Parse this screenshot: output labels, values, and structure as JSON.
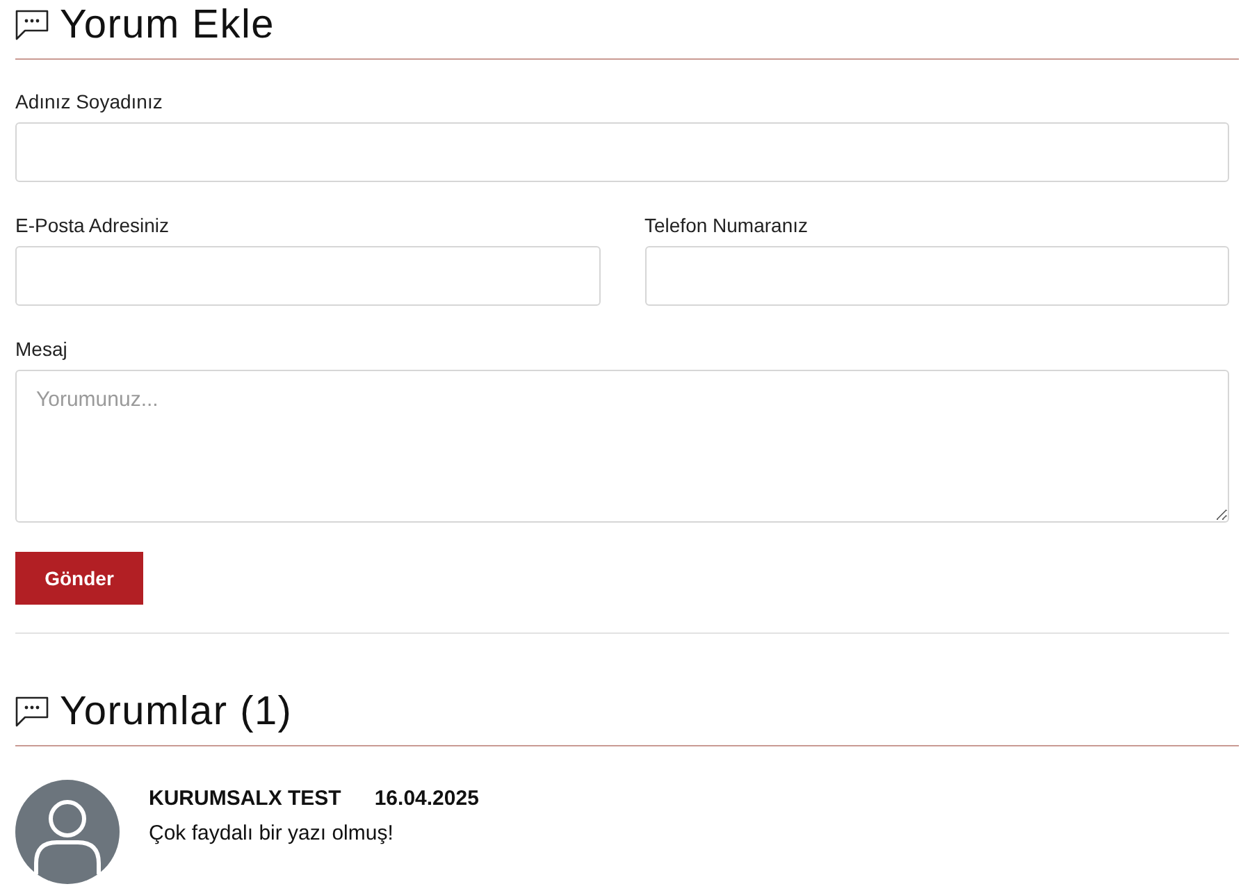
{
  "form_section": {
    "title": "Yorum Ekle"
  },
  "field_rows": [
    [
      {
        "label": "Adınız Soyadınız",
        "kind": "text"
      }
    ],
    [
      {
        "label": "E-Posta Adresiniz",
        "kind": "text"
      },
      {
        "label": "Telefon Numaranız",
        "kind": "text"
      }
    ],
    [
      {
        "label": "Mesaj",
        "kind": "textarea",
        "placeholder": "Yorumunuz..."
      }
    ]
  ],
  "submit_button": "Gönder",
  "comments_section": {
    "title": "Yorumlar (1)"
  },
  "comments": [
    {
      "author": "KURUMSALX TEST",
      "date": "16.04.2025",
      "text": "Çok faydalı bir yazı olmuş!"
    }
  ]
}
